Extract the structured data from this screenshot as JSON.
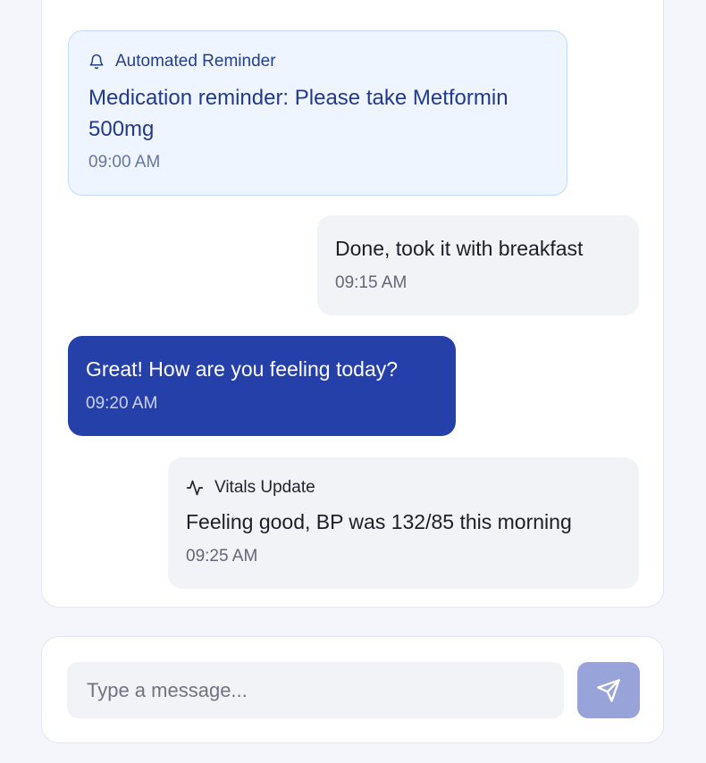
{
  "messages": [
    {
      "kind": "automated_reminder",
      "tag_label": "Automated Reminder",
      "tag_icon": "bell-icon",
      "text": "Medication reminder: Please take Metformin 500mg",
      "time": "09:00 AM"
    },
    {
      "kind": "patient",
      "text": "Done, took it with breakfast",
      "time": "09:15 AM"
    },
    {
      "kind": "care_team",
      "text": "Great! How are you feeling today?",
      "time": "09:20 AM"
    },
    {
      "kind": "vitals_update",
      "tag_label": "Vitals Update",
      "tag_icon": "activity-icon",
      "text": "Feeling good, BP was 132/85 this morning",
      "time": "09:25 AM"
    }
  ],
  "composer": {
    "placeholder": "Type a message...",
    "value": "",
    "send_icon": "send-icon"
  },
  "colors": {
    "care_team_bubble": "#2540a9",
    "reminder_bubble": "#eef5fe",
    "reminder_border": "#c4dbf7",
    "neutral_bubble": "#f2f3f6",
    "send_button": "#97a3d9",
    "page_background": "#f5f6fb"
  }
}
